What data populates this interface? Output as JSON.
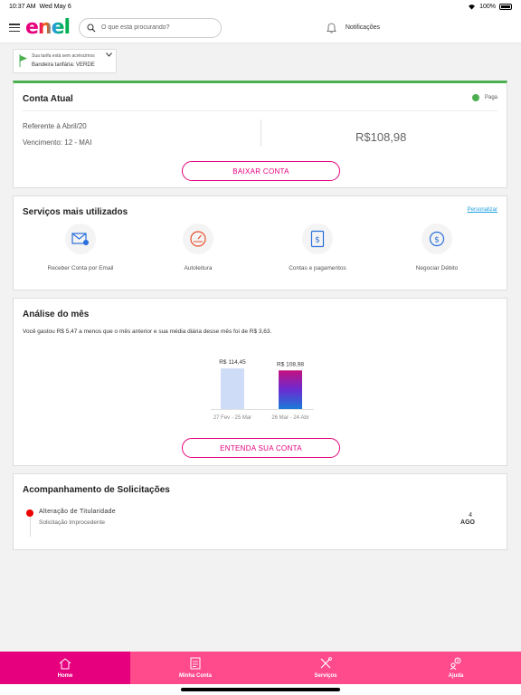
{
  "status_bar": {
    "time": "10:37 AM",
    "date": "Wed May 6",
    "battery": "100%"
  },
  "header": {
    "logo_text": "enel",
    "search_placeholder": "O que está procurando?",
    "notifications_label": "Notificações"
  },
  "tariff": {
    "line1": "Sua tarifa está sem acréscimos",
    "line2": "Bandeira tarifária: VERDE"
  },
  "conta_atual": {
    "title": "Conta Atual",
    "status": "Paga",
    "referente": "Referente à Abril/20",
    "vencimento": "Vencimento: 12 - MAI",
    "valor": "R$108,98",
    "button": "BAIXAR CONTA"
  },
  "servicos": {
    "title": "Serviços mais utilizados",
    "personalizar": "Personalizar",
    "items": [
      {
        "label": "Receber Conta por Email",
        "icon": "email-icon"
      },
      {
        "label": "Autoleitura",
        "icon": "meter-icon"
      },
      {
        "label": "Contas e pagamentos",
        "icon": "bill-icon"
      },
      {
        "label": "Negociar Débito",
        "icon": "money-icon"
      }
    ]
  },
  "analise": {
    "title": "Análise do mês",
    "text": "Você gastou R$ 5,47 a menos que o mês anterior e sua média diária desse mês foi de R$ 3,63.",
    "button": "ENTENDA SUA CONTA"
  },
  "chart_data": {
    "type": "bar",
    "categories": [
      "27 Fev - 25 Mar",
      "26 Mar - 24 Abr"
    ],
    "values": [
      114.45,
      108.98
    ],
    "value_labels": [
      "R$ 114,45",
      "R$ 108,98"
    ],
    "colors": [
      "#cfdcf7",
      "gradient-pink-blue"
    ],
    "ylim": [
      0,
      120
    ],
    "grid": false
  },
  "acompanhamento": {
    "title": "Acompanhamento de Solicitações",
    "items": [
      {
        "title": "Alteração de Titularidade",
        "status": "Solicitação Improcedente",
        "day": "4",
        "month": "AGO"
      }
    ]
  },
  "nav": {
    "items": [
      {
        "label": "Home",
        "icon": "home-icon"
      },
      {
        "label": "Minha Conta",
        "icon": "document-icon"
      },
      {
        "label": "Serviços",
        "icon": "tools-icon"
      },
      {
        "label": "Ajuda",
        "icon": "help-icon"
      }
    ]
  }
}
